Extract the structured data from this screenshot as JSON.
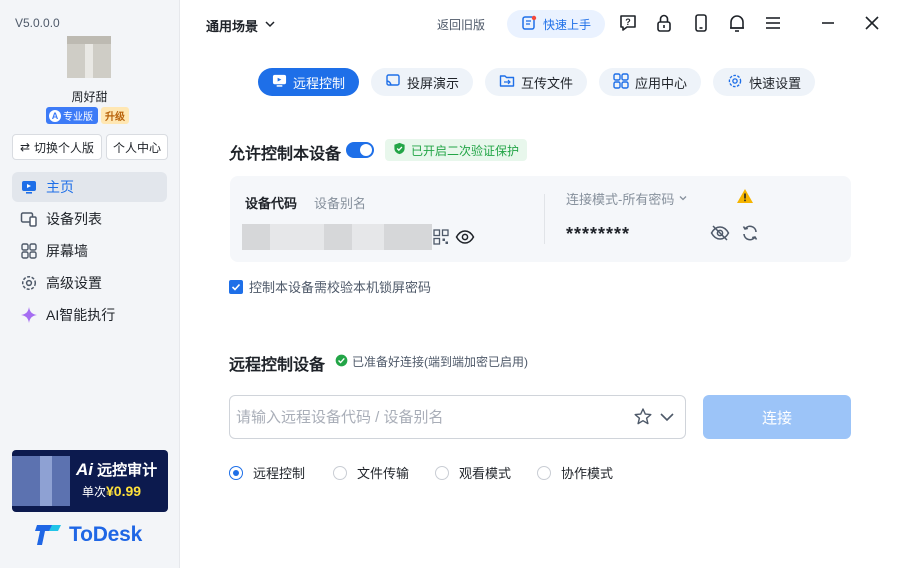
{
  "sidebar": {
    "version": "V5.0.0.0",
    "username": "周好甜",
    "pro_badge": "专业版",
    "upgrade_badge": "升级",
    "switch_label": "切换个人版",
    "center_label": "个人中心",
    "items": [
      {
        "label": "主页",
        "icon": "monitor-icon",
        "active": true
      },
      {
        "label": "设备列表",
        "icon": "device-list-icon"
      },
      {
        "label": "屏幕墙",
        "icon": "grid-icon"
      },
      {
        "label": "高级设置",
        "icon": "gear-icon"
      },
      {
        "label": "AI智能执行",
        "icon": "sparkle-icon"
      }
    ],
    "promo": {
      "ai_text": "Ai",
      "title": "远控审计",
      "price_prefix": "单次",
      "price": "¥0.99"
    },
    "logo_text": "ToDesk"
  },
  "header": {
    "scene": "通用场景",
    "back_old": "返回旧版",
    "quick_start": "快速上手"
  },
  "tabs": [
    {
      "label": "远程控制",
      "icon": "remote-icon",
      "active": true
    },
    {
      "label": "投屏演示",
      "icon": "cast-icon"
    },
    {
      "label": "互传文件",
      "icon": "folder-icon"
    },
    {
      "label": "应用中心",
      "icon": "apps-icon"
    },
    {
      "label": "快速设置",
      "icon": "gear-icon"
    }
  ],
  "allow": {
    "title": "允许控制本设备",
    "verify_badge": "已开启二次验证保护",
    "code_label": "设备代码",
    "alias_label": "设备别名",
    "mode_label": "连接模式-所有密码",
    "password": "********",
    "checkbox_label": "控制本设备需校验本机锁屏密码"
  },
  "remote": {
    "title": "远程控制设备",
    "ready_text": "已准备好连接(端到端加密已启用)",
    "search_placeholder": "请输入远程设备代码 / 设备别名",
    "connect": "连接",
    "modes": [
      "远程控制",
      "文件传输",
      "观看模式",
      "协作模式"
    ]
  },
  "colors": {
    "accent": "#1e6fe8",
    "success": "#23a547",
    "warning": "#f5b400"
  }
}
